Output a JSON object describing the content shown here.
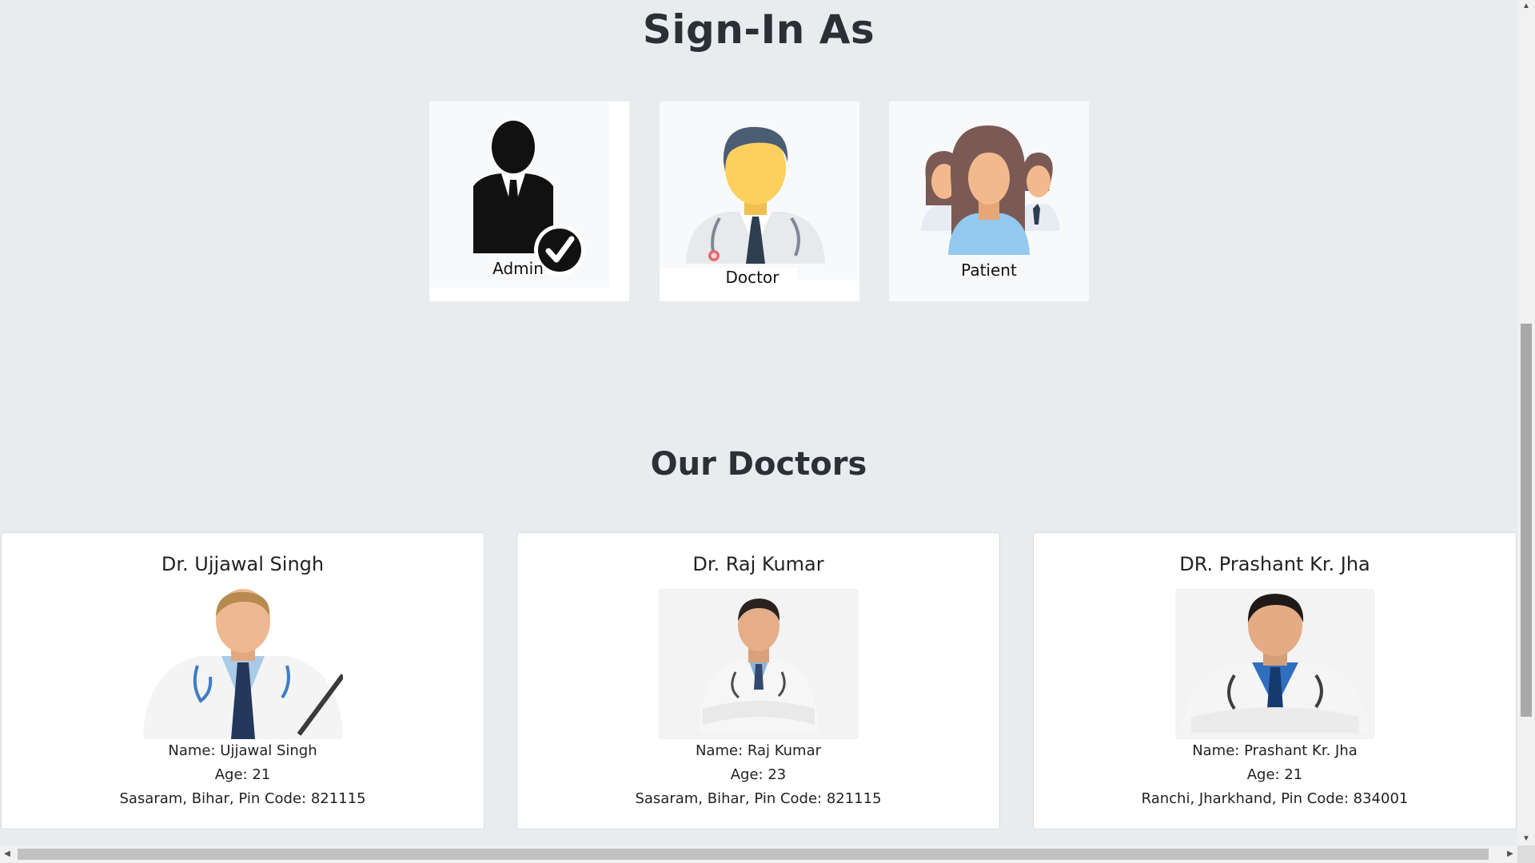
{
  "signin": {
    "title": "Sign-In As",
    "roles": [
      {
        "label": "Admin",
        "icon": "admin-check-icon"
      },
      {
        "label": "Doctor",
        "icon": "doctor-icon"
      },
      {
        "label": "Patient",
        "icon": "patients-group-icon"
      }
    ]
  },
  "doctors": {
    "title": "Our Doctors",
    "cards": [
      {
        "heading": "Dr. Ujjawal Singh",
        "name_line": "Name: Ujjawal Singh",
        "age_line": "Age: 21",
        "address_line": "Sasaram, Bihar, Pin Code: 821115"
      },
      {
        "heading": "Dr. Raj Kumar",
        "name_line": "Name: Raj Kumar",
        "age_line": "Age: 23",
        "address_line": "Sasaram, Bihar, Pin Code: 821115"
      },
      {
        "heading": "DR. Prashant Kr. Jha",
        "name_line": "Name: Prashant Kr. Jha",
        "age_line": "Age: 21",
        "address_line": "Ranchi, Jharkhand, Pin Code: 834001"
      }
    ]
  },
  "colors": {
    "page_bg": "#e9ecef",
    "card_bg": "#ffffff",
    "role_card_bg": "#f8f9fa",
    "text": "#212529"
  }
}
